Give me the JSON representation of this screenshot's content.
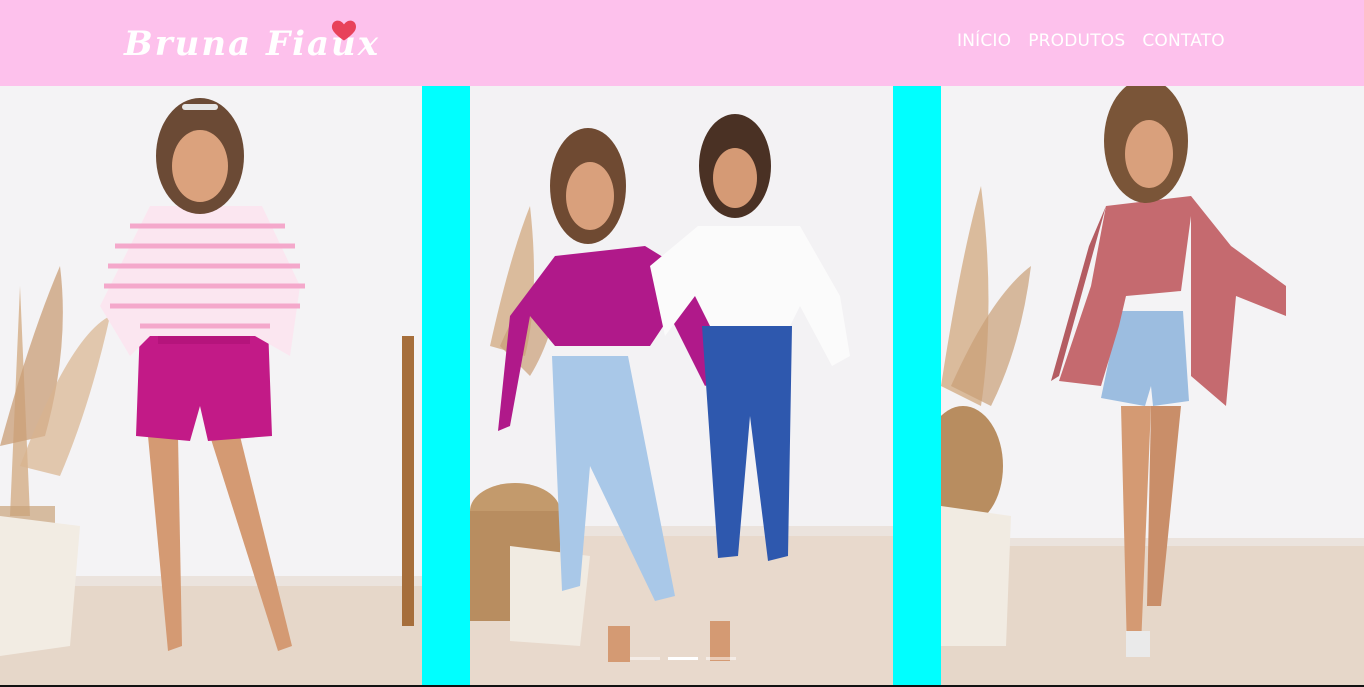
{
  "brand": {
    "name": "Bruna Fiaux",
    "heart_color": "#e8425a"
  },
  "nav": {
    "items": [
      {
        "label": "INÍCIO"
      },
      {
        "label": "PRODUTOS"
      },
      {
        "label": "CONTATO"
      }
    ]
  },
  "colors": {
    "header_bg": "#fdc1ec",
    "carousel_bg": "#00ffff",
    "nav_text": "#ffffff"
  },
  "carousel": {
    "slides": [
      {
        "description": "model-pink-striped-top-magenta-shorts"
      },
      {
        "description": "two-models-magenta-white-crop-tops-jeans"
      },
      {
        "description": "model-rose-blazer-white-top-denim-shorts"
      }
    ],
    "active_index": 1,
    "indicator_count": 3
  }
}
